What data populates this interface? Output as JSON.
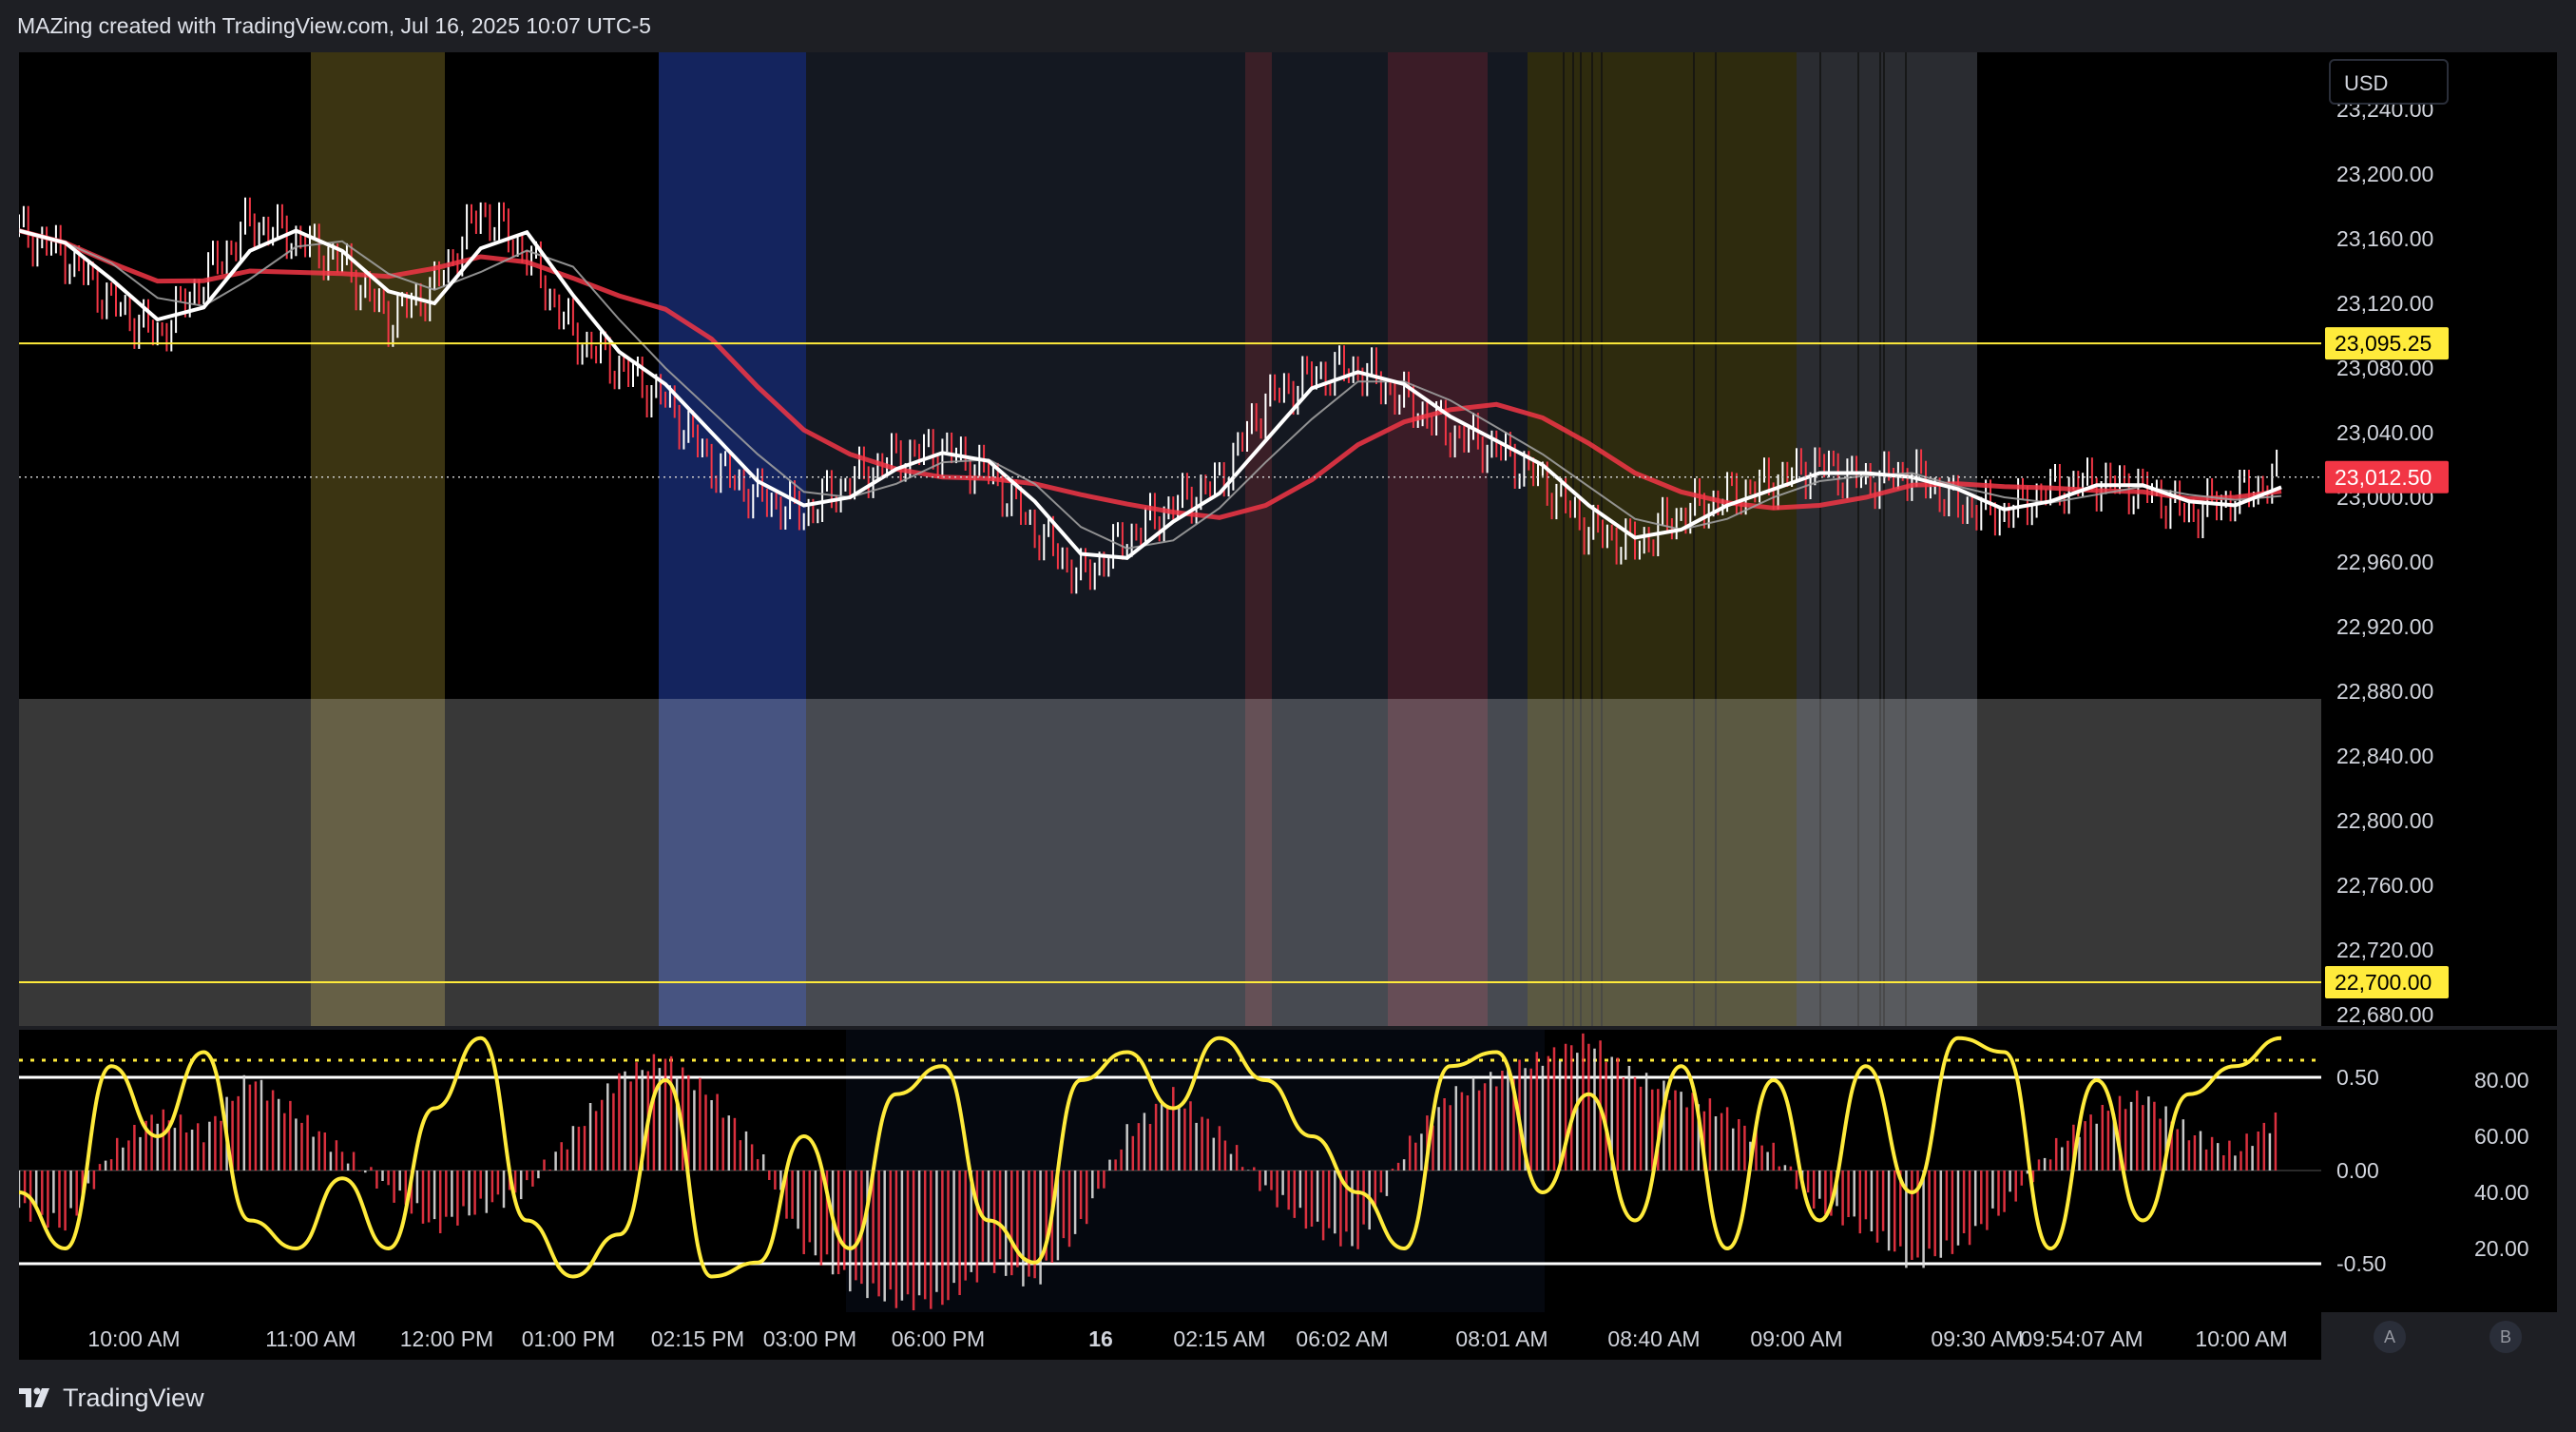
{
  "header": {
    "attribution": "MAZing created with TradingView.com, Jul 16, 2025 10:07 UTC-5"
  },
  "price_scale": {
    "currency_button": "USD"
  },
  "footer": {
    "brand": "TradingView"
  },
  "scale_buttons": {
    "auto": "A",
    "log": "B"
  },
  "colors": {
    "bull_candle": "#ffffff",
    "bear_candle": "#f23645",
    "ma_fast": "#9e9e9e",
    "ma_mid": "#ffffff",
    "ma_slow": "#f23645",
    "level_line": "#ffeb3b",
    "oscillator_line": "#ffeb3b",
    "last_price_badge": "#f23645",
    "level_badge": "#ffeb3b"
  },
  "chart_data": [
    {
      "type": "line",
      "name": "price",
      "ylim": [
        22680,
        23240
      ],
      "yticks": [
        "23,240.00",
        "23,200.00",
        "23,160.00",
        "23,120.00",
        "23,080.00",
        "23,040.00",
        "23,000.00",
        "22,960.00",
        "22,920.00",
        "22,880.00",
        "22,840.00",
        "22,800.00",
        "22,760.00",
        "22,720.00",
        "22,680.00"
      ],
      "xticks": [
        "10:00 AM",
        "11:00 AM",
        "12:00 PM",
        "01:00 PM",
        "02:15 PM",
        "03:00 PM",
        "06:00 PM",
        "16",
        "02:15 AM",
        "06:02 AM",
        "08:01 AM",
        "08:40 AM",
        "09:00 AM",
        "09:30 AM",
        "09:54:07 AM",
        "10:00 AM"
      ],
      "close": [
        23165,
        23150,
        23120,
        23100,
        23135,
        23170,
        23160,
        23145,
        23110,
        23130,
        23178,
        23150,
        23100,
        23080,
        23060,
        23020,
        23000,
        22990,
        23010,
        23025,
        23030,
        23015,
        22980,
        22950,
        22975,
        22995,
        23010,
        23060,
        23075,
        23080,
        23060,
        23040,
        23030,
        23010,
        22980,
        22970,
        22990,
        23000,
        23010,
        23020,
        23010,
        23015,
        22995,
        22990,
        23005,
        23010,
        23005,
        22990,
        23000,
        23012.5
      ],
      "last_price": 23012.5,
      "last_price_label": "23,012.50",
      "levels": [
        {
          "value": 23095.25,
          "label": "23,095.25"
        },
        {
          "value": 22700.0,
          "label": "22,700.00"
        }
      ]
    },
    {
      "type": "bar",
      "name": "oscillator",
      "yticks_left": [
        "0.50",
        "0.00",
        "-0.50"
      ],
      "yticks_right": [
        "80.00",
        "60.00",
        "40.00",
        "20.00"
      ],
      "histogram": [
        -0.2,
        -0.3,
        0.1,
        0.3,
        0.2,
        0.5,
        0.3,
        0.1,
        -0.1,
        -0.3,
        -0.2,
        -0.1,
        0.2,
        0.5,
        0.6,
        0.4,
        0.1,
        -0.4,
        -0.6,
        -0.7,
        -0.7,
        -0.5,
        -0.6,
        -0.3,
        0.2,
        0.4,
        0.2,
        -0.1,
        -0.3,
        -0.4,
        0.1,
        0.4,
        0.5,
        0.6,
        0.7,
        0.5,
        0.4,
        0.3,
        0.1,
        -0.2,
        -0.3,
        -0.5,
        -0.4,
        -0.2,
        0.1,
        0.3,
        0.4,
        0.2,
        0.1,
        0.3
      ],
      "stochastic": [
        40,
        20,
        85,
        60,
        90,
        30,
        20,
        45,
        20,
        70,
        95,
        30,
        10,
        25,
        80,
        10,
        15,
        60,
        20,
        75,
        85,
        30,
        15,
        80,
        90,
        70,
        95,
        80,
        60,
        40,
        20,
        85,
        90,
        40,
        75,
        30,
        85,
        20,
        80,
        30,
        85,
        40,
        95,
        90,
        20,
        80,
        30,
        75,
        85,
        95
      ]
    }
  ]
}
